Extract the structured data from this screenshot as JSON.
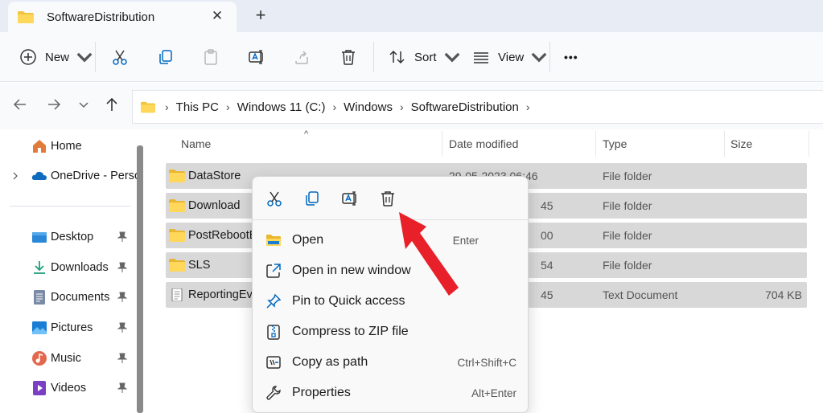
{
  "tab": {
    "title": "SoftwareDistribution",
    "close": "✕",
    "new_tab": "+"
  },
  "toolbar": {
    "new_label": "New",
    "sort_label": "Sort",
    "view_label": "View",
    "more": "•••"
  },
  "address": {
    "crumbs": [
      "This PC",
      "Windows 11 (C:)",
      "Windows",
      "SoftwareDistribution"
    ],
    "sep": "›"
  },
  "sidebar": {
    "items": [
      {
        "label": "Home"
      },
      {
        "label": "OneDrive - Perso"
      },
      {
        "label": "Desktop"
      },
      {
        "label": "Downloads"
      },
      {
        "label": "Documents"
      },
      {
        "label": "Pictures"
      },
      {
        "label": "Music"
      },
      {
        "label": "Videos"
      }
    ]
  },
  "columns": {
    "name": "Name",
    "date": "Date modified",
    "type": "Type",
    "size": "Size",
    "sort_indicator": "^"
  },
  "files": [
    {
      "name": "DataStore",
      "date": "29-05-2023 06:46",
      "type": "File folder",
      "size": ""
    },
    {
      "name": "Download",
      "date": "45",
      "type": "File folder",
      "size": ""
    },
    {
      "name": "PostRebootE",
      "date": "00",
      "type": "File folder",
      "size": ""
    },
    {
      "name": "SLS",
      "date": "54",
      "type": "File folder",
      "size": ""
    },
    {
      "name": "ReportingEve",
      "date": "45",
      "type": "Text Document",
      "size": "704 KB"
    }
  ],
  "context_menu": {
    "items": [
      {
        "label": "Open",
        "shortcut": "Enter"
      },
      {
        "label": "Open in new window",
        "shortcut": ""
      },
      {
        "label": "Pin to Quick access",
        "shortcut": ""
      },
      {
        "label": "Compress to ZIP file",
        "shortcut": ""
      },
      {
        "label": "Copy as path",
        "shortcut": "Ctrl+Shift+C"
      },
      {
        "label": "Properties",
        "shortcut": "Alt+Enter"
      }
    ]
  },
  "colors": {
    "accent": "#0067c0",
    "folder": "#f0c43c",
    "annotation_arrow": "#e8202a"
  }
}
